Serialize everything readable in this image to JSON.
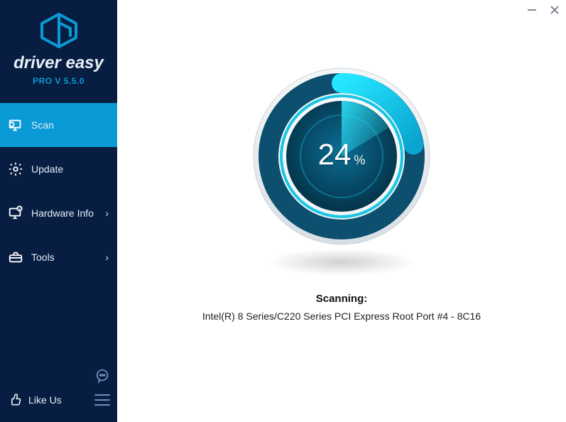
{
  "brand": {
    "name": "driver easy",
    "version_label": "PRO V 5.5.0"
  },
  "colors": {
    "sidebar_bg": "#071d41",
    "accent": "#0a9ad5",
    "ring_outer": "#0c4f6f",
    "ring_bright": "#1fd0e8",
    "ring_dark": "#063b52"
  },
  "nav": {
    "items": [
      {
        "id": "scan",
        "label": "Scan",
        "has_sub": false,
        "active": true
      },
      {
        "id": "update",
        "label": "Update",
        "has_sub": false,
        "active": false
      },
      {
        "id": "hardware",
        "label": "Hardware Info",
        "has_sub": true,
        "active": false
      },
      {
        "id": "tools",
        "label": "Tools",
        "has_sub": true,
        "active": false
      }
    ]
  },
  "footer": {
    "like_label": "Like Us"
  },
  "scan": {
    "percent_value": "24",
    "percent_symbol": "%",
    "status_title": "Scanning:",
    "status_detail": "Intel(R) 8 Series/C220 Series PCI Express Root Port #4 - 8C16"
  }
}
